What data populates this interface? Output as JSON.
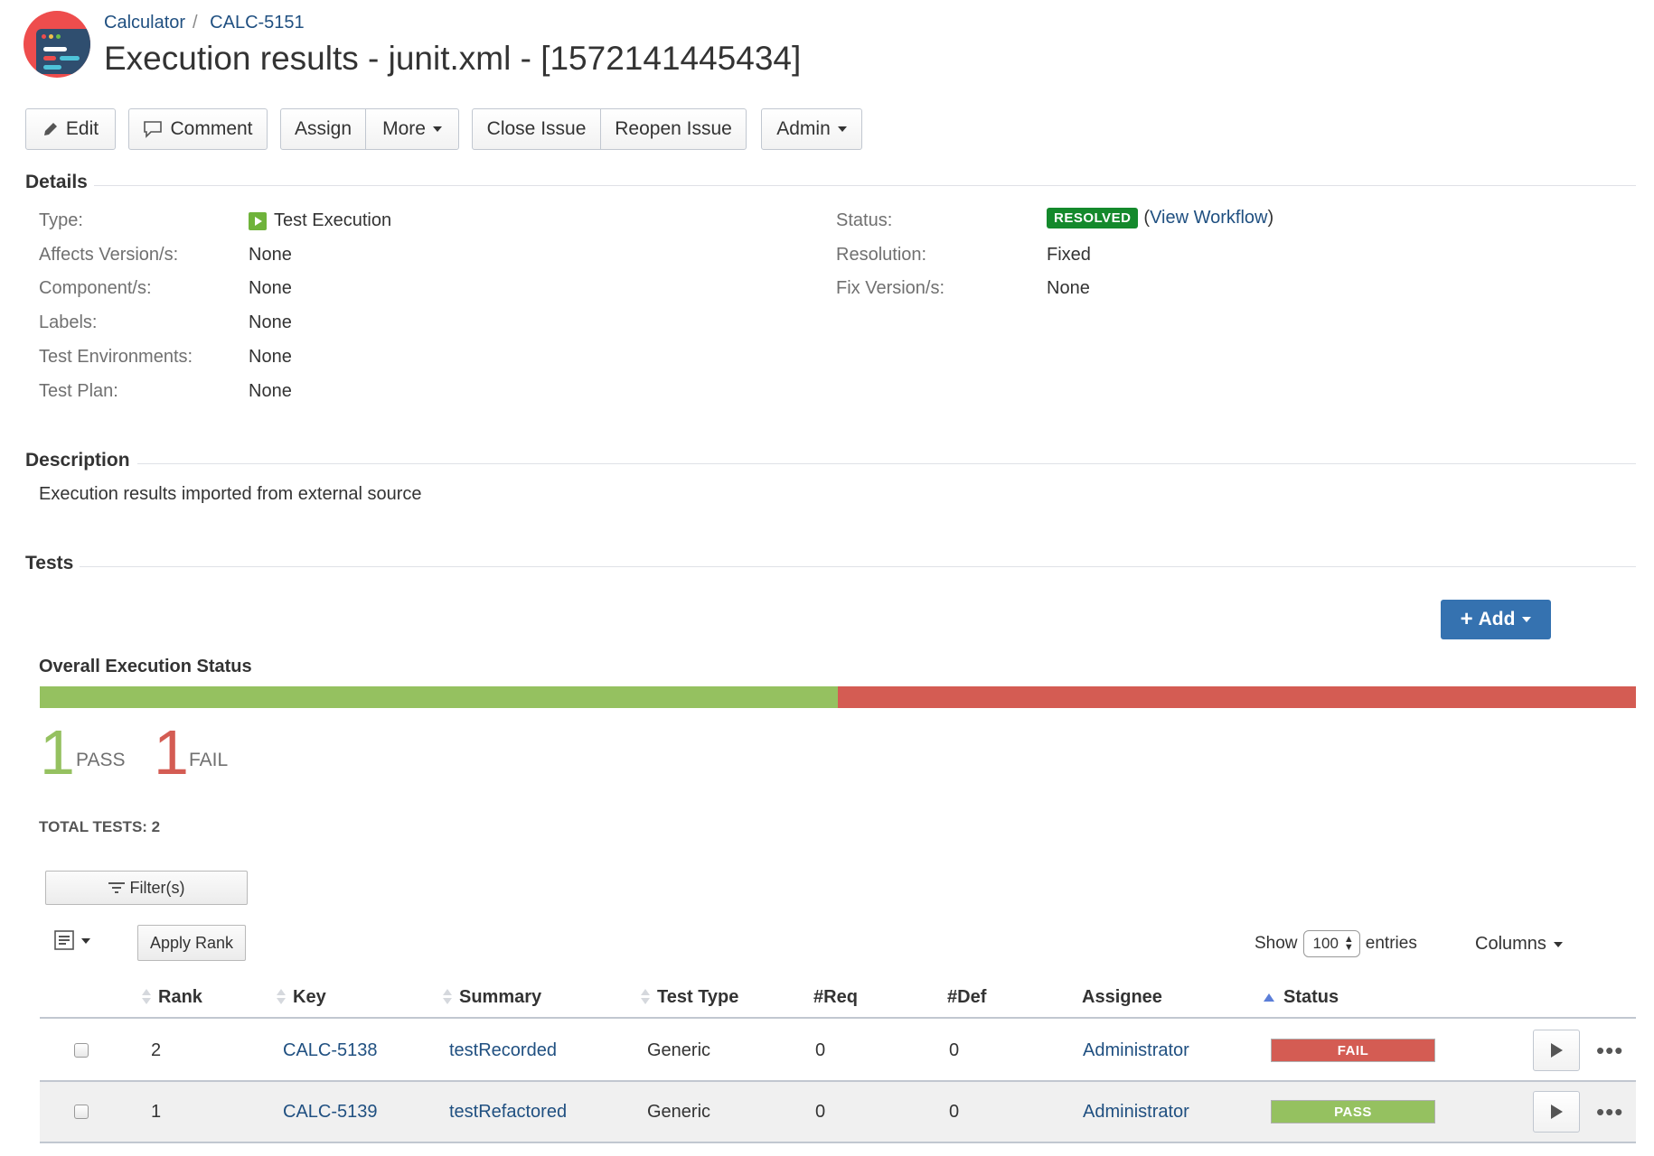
{
  "breadcrumb": {
    "project": "Calculator",
    "issue_key": "CALC-5151"
  },
  "title": "Execution results - junit.xml - [1572141445434]",
  "toolbar": {
    "edit": "Edit",
    "comment": "Comment",
    "assign": "Assign",
    "more": "More",
    "close_issue": "Close Issue",
    "reopen_issue": "Reopen Issue",
    "admin": "Admin"
  },
  "details": {
    "section_title": "Details",
    "left": [
      {
        "label": "Type:",
        "value": "Test Execution"
      },
      {
        "label": "Affects Version/s:",
        "value": "None"
      },
      {
        "label": "Component/s:",
        "value": "None"
      },
      {
        "label": "Labels:",
        "value": "None"
      },
      {
        "label": "Test Environments:",
        "value": "None"
      },
      {
        "label": "Test Plan:",
        "value": "None"
      }
    ],
    "right": [
      {
        "label": "Status:",
        "value": "RESOLVED",
        "link": "View Workflow"
      },
      {
        "label": "Resolution:",
        "value": "Fixed"
      },
      {
        "label": "Fix Version/s:",
        "value": "None"
      }
    ]
  },
  "description": {
    "section_title": "Description",
    "text": "Execution results imported from external source"
  },
  "tests": {
    "section_title": "Tests",
    "add_label": "Add",
    "overall_title": "Overall Execution Status",
    "pass_fraction": 0.5,
    "fail_fraction": 0.5,
    "pass_count": "1",
    "pass_label": "PASS",
    "fail_count": "1",
    "fail_label": "FAIL",
    "total_label": "TOTAL TESTS: 2",
    "filter_label": "Filter(s)",
    "apply_rank_label": "Apply Rank",
    "show_label": "Show",
    "entries_value": "100",
    "entries_label": "entries",
    "columns_label": "Columns",
    "headers": [
      "Rank",
      "Key",
      "Summary",
      "Test Type",
      "#Req",
      "#Def",
      "Assignee",
      "Status"
    ],
    "rows": [
      {
        "rank": "2",
        "key": "CALC-5138",
        "summary": "testRecorded",
        "type": "Generic",
        "req": "0",
        "def": "0",
        "assignee": "Administrator",
        "status": "FAIL"
      },
      {
        "rank": "1",
        "key": "CALC-5139",
        "summary": "testRefactored",
        "type": "Generic",
        "req": "0",
        "def": "0",
        "assignee": "Administrator",
        "status": "PASS"
      }
    ]
  },
  "colors": {
    "pass": "#95c160",
    "fail": "#d45c53",
    "resolved": "#14892c",
    "link": "#205081",
    "add_button": "#3572b0"
  },
  "icons": [
    "app-logo-icon",
    "pencil-icon",
    "speech-bubble-icon",
    "test-execution-icon",
    "plus-icon",
    "filter-icon",
    "table-options-icon",
    "play-icon",
    "more-actions-icon"
  ]
}
